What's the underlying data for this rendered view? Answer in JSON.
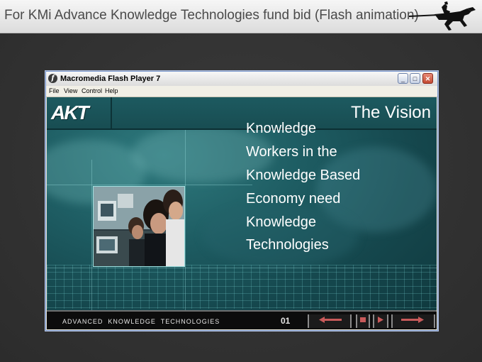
{
  "slide": {
    "title": "For KMi Advance Knowledge Technologies fund bid (Flash animation)"
  },
  "window": {
    "title": "Macromedia Flash Player 7",
    "menu": [
      "File",
      "View",
      "Control",
      "Help"
    ]
  },
  "flash": {
    "logo": "AKT",
    "heading": "The Vision",
    "lines": [
      "Knowledge",
      "Workers in the",
      "Knowledge Based",
      "Economy need",
      "Knowledge",
      "Technologies"
    ],
    "footer": "ADVANCED  KNOWLEDGE  TECHNOLOGIES",
    "frame": "01"
  },
  "colors": {
    "stage_teal": "#1e5d63",
    "nav_black": "#0c0c0c",
    "button_red": "#c44b33"
  },
  "icons": {
    "header_graphic": "knight-on-horseback-icon",
    "player": "flash-player-icon",
    "nav": [
      "arrow-left-icon",
      "stop-icon",
      "play-icon",
      "arrow-right-icon"
    ]
  }
}
